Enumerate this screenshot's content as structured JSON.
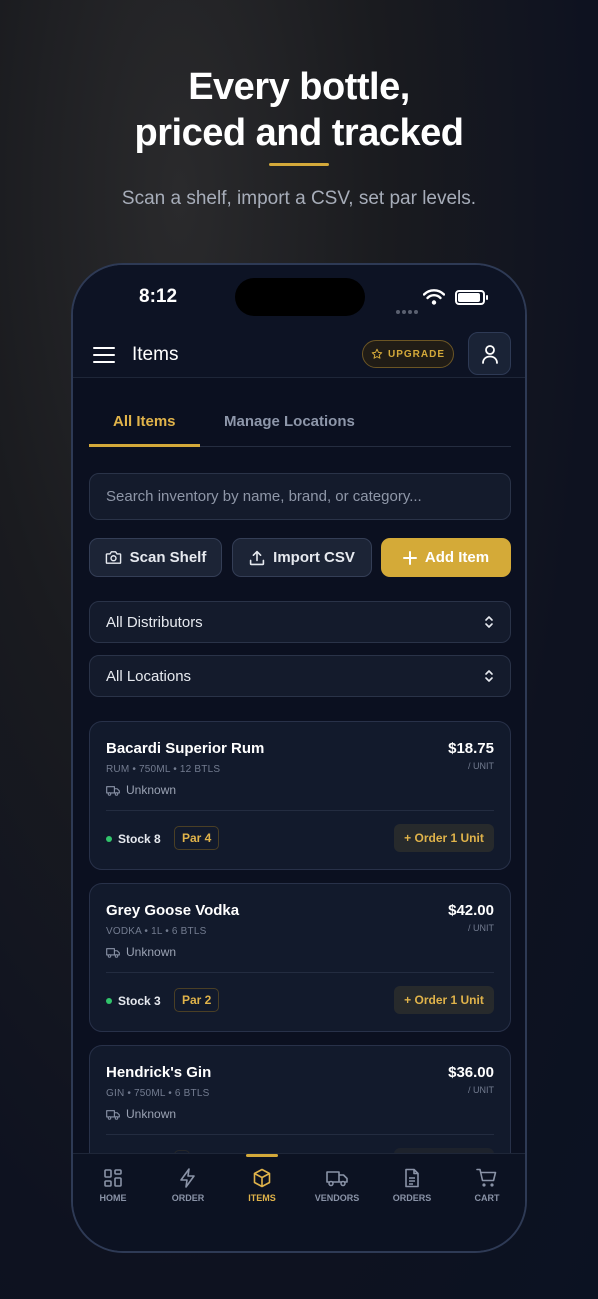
{
  "hero": {
    "title_line1": "Every bottle,",
    "title_line2": "priced and tracked",
    "subtitle": "Scan a shelf, import a CSV, set par levels."
  },
  "status_bar": {
    "time": "8:12"
  },
  "header": {
    "title": "Items",
    "upgrade_label": "UPGRADE"
  },
  "tabs": [
    {
      "label": "All Items",
      "active": true
    },
    {
      "label": "Manage Locations",
      "active": false
    }
  ],
  "search": {
    "placeholder": "Search inventory by name, brand, or category..."
  },
  "actions": {
    "scan_label": "Scan Shelf",
    "import_label": "Import CSV",
    "add_label": "Add Item"
  },
  "filters": {
    "distributor_selected": "All Distributors",
    "location_selected": "All Locations"
  },
  "items": [
    {
      "name": "Bacardi Superior Rum",
      "meta": "RUM • 750ML • 12 BTLS",
      "vendor": "Unknown",
      "price": "$18.75",
      "unit": "/ UNIT",
      "stock": "Stock 8",
      "par": "Par 4",
      "order": "+ Order 1 Unit"
    },
    {
      "name": "Grey Goose Vodka",
      "meta": "VODKA • 1L • 6 BTLS",
      "vendor": "Unknown",
      "price": "$42.00",
      "unit": "/ UNIT",
      "stock": "Stock 3",
      "par": "Par 2",
      "order": "+ Order 1 Unit"
    },
    {
      "name": "Hendrick's Gin",
      "meta": "GIN • 750ML • 6 BTLS",
      "vendor": "Unknown",
      "price": "$36.00",
      "unit": "/ UNIT",
      "stock": "",
      "par": "",
      "order": ""
    }
  ],
  "tabbar": [
    {
      "label": "HOME",
      "icon": "grid-icon"
    },
    {
      "label": "ORDER",
      "icon": "lightning-icon"
    },
    {
      "label": "ITEMS",
      "icon": "box-icon",
      "active": true
    },
    {
      "label": "VENDORS",
      "icon": "truck-icon"
    },
    {
      "label": "ORDERS",
      "icon": "document-icon"
    },
    {
      "label": "CART",
      "icon": "cart-icon"
    }
  ],
  "colors": {
    "accent": "#d4a93a",
    "background": "#0b1020",
    "card": "#121a2c",
    "stock_ok": "#31c46b"
  }
}
